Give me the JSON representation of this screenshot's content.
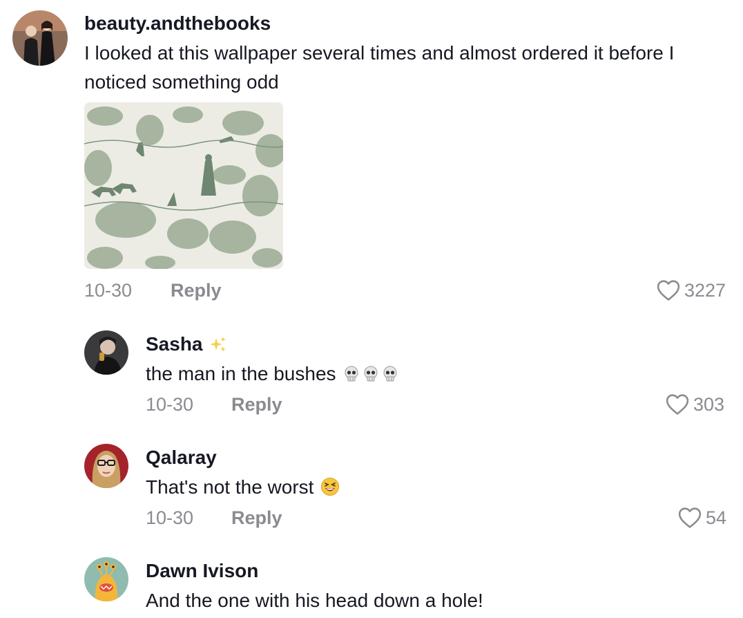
{
  "comments": [
    {
      "username": "beauty.andthebooks",
      "text": "I looked at this wallpaper several times and almost ordered it before I noticed something odd",
      "date": "10-30",
      "reply_label": "Reply",
      "likes": "3227"
    },
    {
      "username": "Sasha",
      "username_emoji": "sparkles-emoji",
      "text": "the man in the bushes",
      "text_emoji": "skull-emoji x3",
      "date": "10-30",
      "reply_label": "Reply",
      "likes": "303"
    },
    {
      "username": "Qalaray",
      "text": "That's not the worst",
      "text_emoji": "laughing-emoji",
      "date": "10-30",
      "reply_label": "Reply",
      "likes": "54"
    },
    {
      "username": "Dawn Ivison",
      "text": "And the one with his head down a hole!"
    }
  ],
  "icons": {
    "like": "heart-outline-icon"
  },
  "colors": {
    "text_primary": "#161823",
    "text_secondary": "#8a8b91",
    "wallpaper_green": "#8fa48a",
    "background": "#ffffff"
  }
}
